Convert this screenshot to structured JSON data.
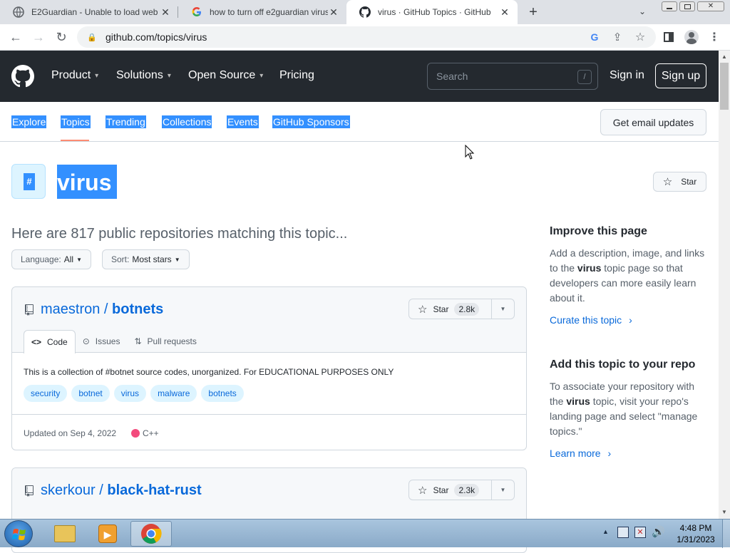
{
  "browser": {
    "tabs": [
      {
        "title": "E2Guardian - Unable to load web",
        "icon": "e2guardian-favicon"
      },
      {
        "title": "how to turn off e2guardian virus",
        "icon": "google-favicon"
      },
      {
        "title": "virus · GitHub Topics · GitHub",
        "icon": "github-favicon"
      }
    ],
    "new_tab": "+",
    "url": "github.com/topics/virus"
  },
  "header": {
    "nav": [
      "Product",
      "Solutions",
      "Open Source",
      "Pricing"
    ],
    "search_placeholder": "Search",
    "search_key": "/",
    "sign_in": "Sign in",
    "sign_up": "Sign up"
  },
  "subnav": {
    "items": [
      "Explore",
      "Topics",
      "Trending",
      "Collections",
      "Events",
      "GitHub Sponsors"
    ],
    "email_button": "Get email updates"
  },
  "topic": {
    "hash": "#",
    "name": "virus",
    "star": "Star",
    "count_text": "Here are 817 public repositories matching this topic...",
    "language_label": "Language:",
    "language_value": "All",
    "sort_label": "Sort:",
    "sort_value": "Most stars"
  },
  "repos": [
    {
      "owner": "maestron",
      "name": "botnets",
      "stars": "2.8k",
      "star_label": "Star",
      "tabs": [
        "Code",
        "Issues",
        "Pull requests"
      ],
      "description": "This is a collection of #botnet source codes, unorganized. For EDUCATIONAL PURPOSES ONLY",
      "tags": [
        "security",
        "botnet",
        "virus",
        "malware",
        "botnets"
      ],
      "updated": "Updated on Sep 4, 2022",
      "language": "C++",
      "language_color": "#f34b7d"
    },
    {
      "owner": "skerkour",
      "name": "black-hat-rust",
      "stars": "2.3k",
      "star_label": "Star"
    }
  ],
  "sidebar": {
    "improve_title": "Improve this page",
    "improve_text_1": "Add a description, image, and links to the ",
    "improve_topic": "virus",
    "improve_text_2": " topic page so that developers can more easily learn about it.",
    "curate_link": "Curate this topic",
    "add_title": "Add this topic to your repo",
    "add_text_1": "To associate your repository with the ",
    "add_topic": "virus",
    "add_text_2": " topic, visit your repo's landing page and select \"manage topics.\"",
    "learn_link": "Learn more"
  },
  "taskbar": {
    "time": "4:48 PM",
    "date": "1/31/2023"
  },
  "colors": {
    "github_header": "#24292f",
    "link": "#0969da",
    "selection": "#3390ff",
    "active_underline": "#fd8c73"
  }
}
